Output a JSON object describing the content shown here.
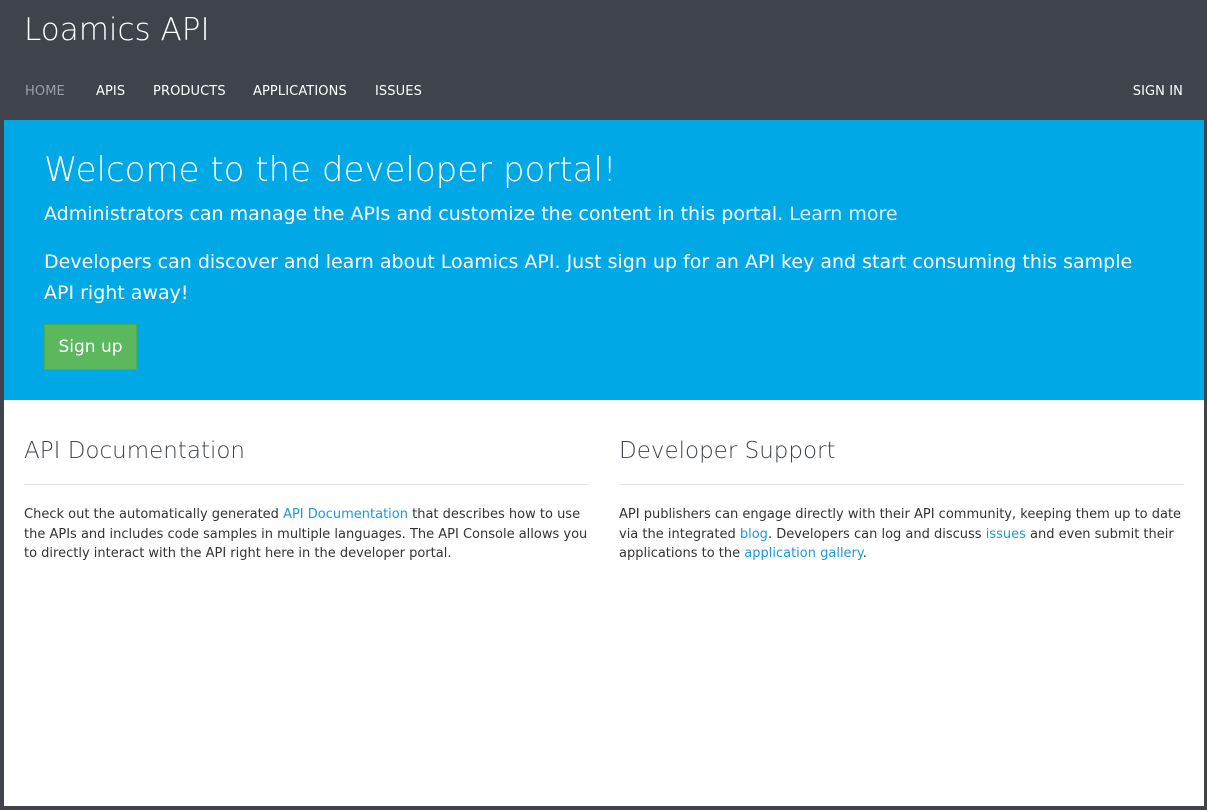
{
  "header": {
    "brand": "Loamics API",
    "nav": [
      {
        "label": "HOME",
        "active": true
      },
      {
        "label": "APIS"
      },
      {
        "label": "PRODUCTS"
      },
      {
        "label": "APPLICATIONS"
      },
      {
        "label": "ISSUES"
      }
    ],
    "sign_in": "SIGN IN"
  },
  "hero": {
    "title": "Welcome to the developer portal!",
    "admin_text": "Administrators can manage the APIs and customize the content in this portal.",
    "learn_more": "Learn more",
    "dev_text": "Developers can discover and learn about Loamics API. Just sign up for an API key and start consuming this sample API right away!",
    "signup_label": "Sign up"
  },
  "api_docs": {
    "title": "API Documentation",
    "text_before": "Check out the automatically generated ",
    "link": "API Documentation",
    "text_after": " that describes how to use the APIs and includes code samples in multiple languages. The API Console allows you to directly interact with the API right here in the developer portal."
  },
  "dev_support": {
    "title": "Developer Support",
    "text_1": "API publishers can engage directly with their API community, keeping them up to date via the integrated ",
    "blog_link": "blog",
    "text_2": ". Developers can log and discuss ",
    "issues_link": "issues",
    "text_3": " and even submit their applications to the ",
    "gallery_link": "application gallery",
    "text_4": "."
  },
  "colors": {
    "header_bg": "#3e434c",
    "hero_bg": "#00a9e6",
    "signup_bg": "#5cb85c",
    "link": "#1a9ad6"
  }
}
